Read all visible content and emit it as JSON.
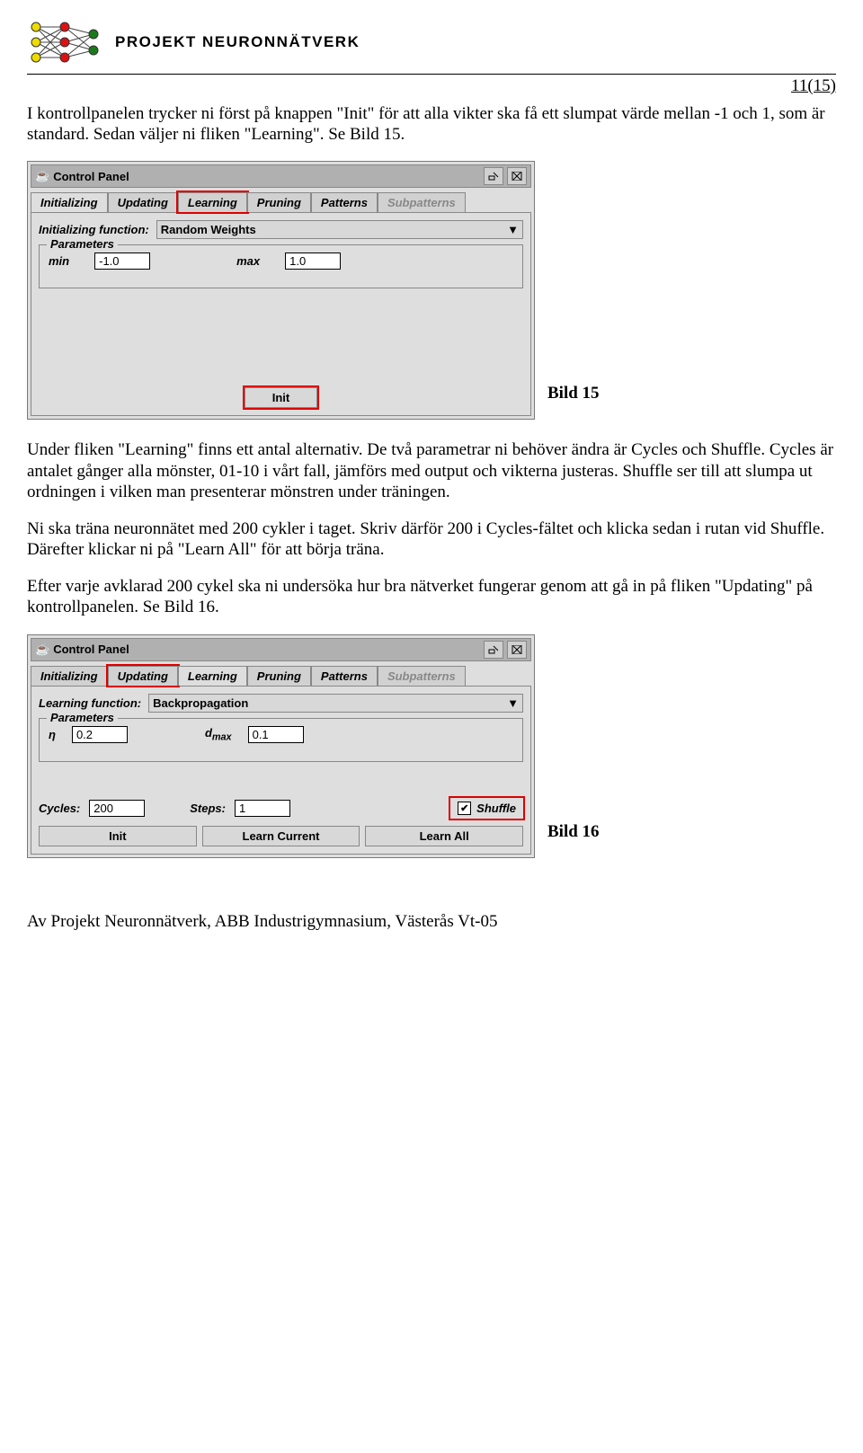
{
  "header": {
    "project_name": "PROJEKT NEURONNÄTVERK"
  },
  "page_number": "11(15)",
  "paragraphs": {
    "p1": "I kontrollpanelen trycker ni först på knappen \"Init\" för att alla vikter ska få ett slumpat värde mellan -1 och 1, som är standard. Sedan väljer ni fliken \"Learning\". Se Bild 15.",
    "p2": "Under fliken \"Learning\" finns ett antal alternativ. De två parametrar ni behöver ändra är Cycles och Shuffle. Cycles är antalet gånger alla mönster, 01-10 i vårt fall, jämförs med output och vikterna justeras. Shuffle ser till att slumpa ut ordningen i vilken man presenterar mönstren under träningen.",
    "p3": "Ni ska träna neuronnätet med 200 cykler i taget. Skriv därför 200 i Cycles-fältet och klicka sedan i rutan vid Shuffle. Därefter klickar ni på \"Learn All\" för att börja träna.",
    "p4": "Efter varje avklarad 200 cykel ska ni undersöka hur bra nätverket fungerar genom att gå in på fliken \"Updating\" på kontrollpanelen. Se Bild 16."
  },
  "captions": {
    "bild15": "Bild 15",
    "bild16": "Bild 16"
  },
  "footer": "Av Projekt Neuronnätverk, ABB Industrigymnasium, Västerås Vt-05",
  "cp1": {
    "title": "Control Panel",
    "tabs": [
      "Initializing",
      "Updating",
      "Learning",
      "Pruning",
      "Patterns",
      "Subpatterns"
    ],
    "funclabel": "Initializing function:",
    "funcvalue": "Random Weights",
    "legend": "Parameters",
    "minlabel": "min",
    "minval": "-1.0",
    "maxlabel": "max",
    "maxval": "1.0",
    "initbtn": "Init"
  },
  "cp2": {
    "title": "Control Panel",
    "tabs": [
      "Initializing",
      "Updating",
      "Learning",
      "Pruning",
      "Patterns",
      "Subpatterns"
    ],
    "funclabel": "Learning function:",
    "funcvalue": "Backpropagation",
    "legend": "Parameters",
    "etalabel": "η",
    "etaval": "0.2",
    "dmaxlabel": "d",
    "dmaxsub": "max",
    "dmaxval": "0.1",
    "cycleslabel": "Cycles:",
    "cyclesval": "200",
    "stepslabel": "Steps:",
    "stepsval": "1",
    "shufflechk": "✔",
    "shufflelabel": "Shuffle",
    "btn_init": "Init",
    "btn_lc": "Learn Current",
    "btn_la": "Learn All"
  }
}
